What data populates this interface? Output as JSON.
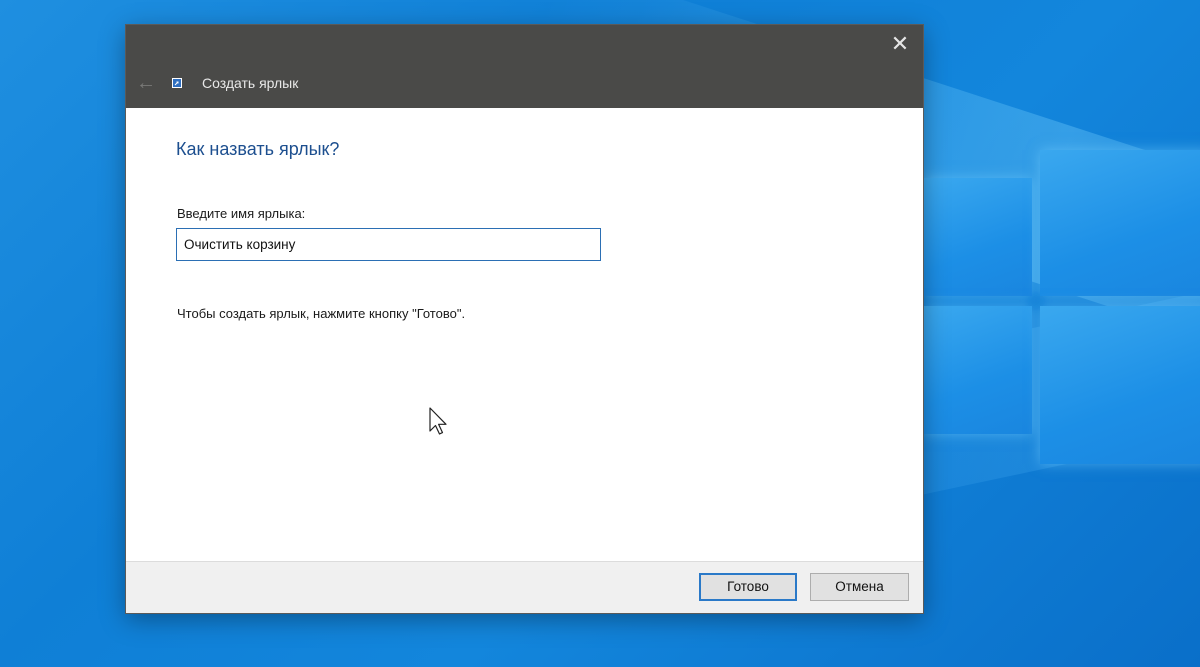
{
  "dialog": {
    "title": "Создать ярлык",
    "heading": "Как назвать ярлык?",
    "field_label": "Введите имя ярлыка:",
    "name_value": "Очистить корзину",
    "hint": "Чтобы создать ярлык, нажмите кнопку \"Готово\".",
    "buttons": {
      "finish": "Готово",
      "cancel": "Отмена"
    },
    "icons": {
      "close": "close-icon",
      "back": "back-arrow-icon",
      "wizard": "shortcut-wizard-icon"
    }
  },
  "colors": {
    "titlebar": "#4a4a48",
    "heading": "#1d4f8f",
    "accent": "#2a79c8",
    "desktop": "#0f7fd6"
  }
}
